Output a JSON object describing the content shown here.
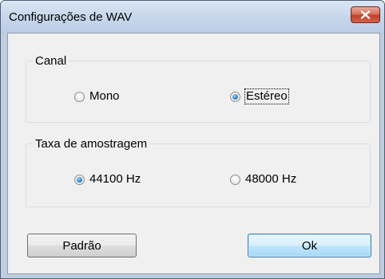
{
  "window": {
    "title": "Configurações de WAV",
    "close_icon": "close-icon"
  },
  "canal": {
    "label": "Canal",
    "options": [
      {
        "label": "Mono",
        "checked": false
      },
      {
        "label": "Estéreo",
        "checked": true
      }
    ]
  },
  "taxa": {
    "label": "Taxa de amostragem",
    "options": [
      {
        "label": "44100 Hz",
        "checked": true
      },
      {
        "label": "48000 Hz",
        "checked": false
      }
    ]
  },
  "buttons": {
    "default_label": "Padrão",
    "ok_label": "Ok"
  },
  "colors": {
    "titlebar": "#c9d8ec",
    "close_button": "#c7503b",
    "dialog_background": "#f0f0f0",
    "radio_selected": "#3c85c4",
    "ok_button": "#bee6fd"
  }
}
